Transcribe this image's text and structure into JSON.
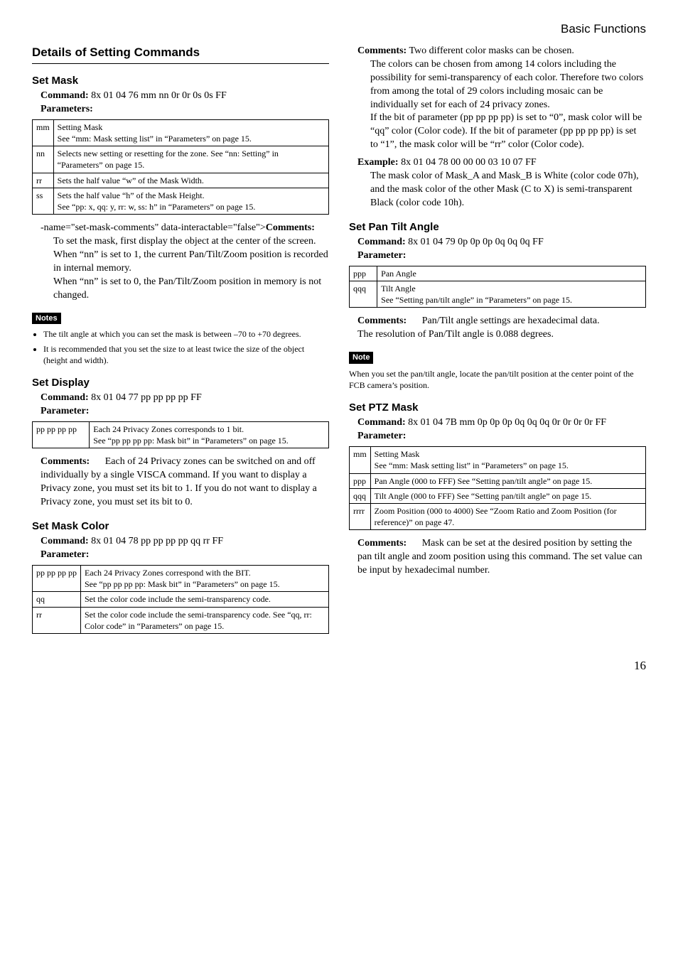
{
  "header": "Basic Functions",
  "page_number": "16",
  "title": "Details of Setting Commands",
  "left": {
    "set_mask": {
      "title": "Set Mask",
      "command_label": "Command:",
      "command": "8x 01 04 76 mm nn 0r 0r 0s 0s FF",
      "parameters_label": "Parameters:",
      "rows": {
        "r0k": "mm",
        "r0v": "Setting Mask\nSee “mm: Mask setting list” in “Parameters” on page 15.",
        "r1k": "nn",
        "r1v": "Selects new setting or resetting for the zone. See “nn: Setting” in “Parameters” on page 15.",
        "r2k": "rr",
        "r2v": "Sets the half value “w” of the Mask Width.",
        "r3k": "ss",
        "r3v": "Sets the half value “h” of the Mask Height.\nSee “pp: x, qq: y, rr: w, ss: h” in “Parameters” on page 15."
      },
      "comments_label": "Comments:",
      "comments_body": "To set the mask, first display the object at the center of the screen. When “nn” is set to 1, the current Pan/Tilt/Zoom position is recorded in internal memory.\nWhen “nn” is set to 0, the Pan/Tilt/Zoom position in memory is not changed.",
      "notes_label": "Notes",
      "notes": {
        "n0": "The tilt angle at which you can set the mask is between –70 to +70 degrees.",
        "n1": "It is recommended that you set the size to at least twice the size of the object (height and width)."
      }
    },
    "set_display": {
      "title": "Set Display",
      "command_label": "Command:",
      "command": "8x 01 04 77 pp pp pp pp FF",
      "parameter_label": "Parameter:",
      "rows": {
        "r0k": "pp pp pp pp",
        "r0v": "Each 24 Privacy Zones corresponds to 1 bit.\nSee “pp pp pp pp: Mask bit” in “Parameters” on page 15."
      },
      "comments_label": "Comments:",
      "comments_body": "Each of 24 Privacy zones can be switched on and off individually by a single VISCA command. If you want to display a Privacy zone, you must set its bit to 1. If you do not want to display a Privacy zone, you must set its bit to 0."
    },
    "set_mask_color": {
      "title": "Set Mask Color",
      "command_label": "Command:",
      "command": "8x 01 04 78 pp pp pp pp qq rr FF",
      "parameter_label": "Parameter:",
      "rows": {
        "r0k": "pp pp pp pp",
        "r0v": "Each 24 Privacy Zones correspond with the BIT.\nSee “pp pp pp pp: Mask bit” in “Parameters” on page 15.",
        "r1k": "qq",
        "r1v": "Set the color code include the semi-transparency code.",
        "r2k": "rr",
        "r2v": "Set the color code include the semi-transparency code. See “qq, rr: Color code” in “Parameters” on page 15."
      }
    }
  },
  "right": {
    "mask_color_cont": {
      "comments_label": "Comments:",
      "comments_head": "Two different color masks can be chosen.",
      "comments_body": "The colors can be chosen from among 14 colors including the possibility for semi-transparency of each color. Therefore two colors from among the total of 29 colors including mosaic can be individually set for each of 24 privacy zones.\nIf the bit of parameter (pp pp pp pp) is set to “0”, mask color will be “qq” color (Color code). If the bit of parameter (pp pp pp pp) is set to “1”, the mask color will be “rr” color (Color code).",
      "example_label": "Example:",
      "example_head": "8x 01 04 78 00 00 00 03 10 07 FF",
      "example_body": "The mask color of Mask_A and Mask_B is White (color code 07h), and the mask color of the other Mask (C to X) is semi-transparent Black (color code 10h)."
    },
    "set_pan_tilt": {
      "title": "Set Pan Tilt Angle",
      "command_label": "Command:",
      "command": "8x 01 04 79 0p 0p 0p 0q 0q 0q FF",
      "parameter_label": "Parameter:",
      "rows": {
        "r0k": "ppp",
        "r0v": "Pan Angle",
        "r1k": "qqq",
        "r1v": "Tilt Angle\nSee “Setting pan/tilt angle” in “Parameters” on page 15."
      },
      "comments_label": "Comments:",
      "comments_body": "Pan/Tilt angle settings are hexadecimal data.\nThe resolution of Pan/Tilt angle is 0.088 degrees.",
      "note_label": "Note",
      "note_body": "When you set the pan/tilt angle, locate the pan/tilt position at the center point of the FCB camera’s position."
    },
    "set_ptz": {
      "title": "Set PTZ Mask",
      "command_label": "Command:",
      "command": "8x 01 04 7B mm 0p 0p 0p 0q 0q 0q 0r 0r 0r 0r FF",
      "parameter_label": "Parameter:",
      "rows": {
        "r0k": "mm",
        "r0v": "Setting Mask\nSee “mm: Mask setting list” in “Parameters” on page 15.",
        "r1k": "ppp",
        "r1v": "Pan Angle (000 to FFF) See “Setting pan/tilt angle” on page 15.",
        "r2k": "qqq",
        "r2v": "Tilt Angle (000 to FFF) See “Setting pan/tilt angle” on page 15.",
        "r3k": "rrrr",
        "r3v": "Zoom Position (000 to 4000) See “Zoom Ratio and Zoom Position (for reference)” on page 47."
      },
      "comments_label": "Comments:",
      "comments_body": "Mask can be set at the desired position by setting the pan tilt angle and zoom position using this command. The set value can be input by hexadecimal number."
    }
  }
}
